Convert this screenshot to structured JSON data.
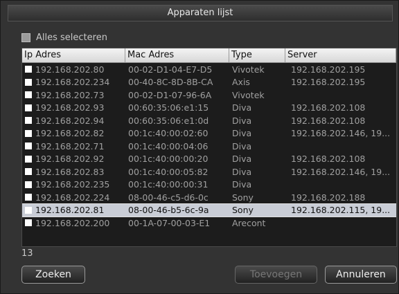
{
  "dialog": {
    "title": "Apparaten lijst",
    "select_all_label": "Alles selecteren",
    "count": "13"
  },
  "table": {
    "headers": [
      "Ip Adres",
      "Mac Adres",
      "Type",
      "Server"
    ],
    "rows": [
      {
        "ip": "192.168.202.80",
        "mac": "00-02-D1-04-E7-D5",
        "type": "Vivotek",
        "server": "192.168.202.195"
      },
      {
        "ip": "192.168.202.234",
        "mac": "00-40-8C-8D-8B-CA",
        "type": "Axis",
        "server": "192.168.202.195"
      },
      {
        "ip": "192.168.202.73",
        "mac": "00-02-D1-07-96-6A",
        "type": "Vivotek",
        "server": ""
      },
      {
        "ip": "192.168.202.93",
        "mac": "00:60:35:06:e1:15",
        "type": "Diva",
        "server": "192.168.202.108"
      },
      {
        "ip": "192.168.202.94",
        "mac": "00:60:35:06:e1:0d",
        "type": "Diva",
        "server": "192.168.202.108"
      },
      {
        "ip": "192.168.202.82",
        "mac": "00:1c:40:00:02:60",
        "type": "Diva",
        "server": "192.168.202.146, 19..."
      },
      {
        "ip": "192.168.202.71",
        "mac": "00:1c:40:00:04:06",
        "type": "Diva",
        "server": ""
      },
      {
        "ip": "192.168.202.92",
        "mac": "00:1c:40:00:00:20",
        "type": "Diva",
        "server": "192.168.202.108"
      },
      {
        "ip": "192.168.202.83",
        "mac": "00:1c:40:00:05:82",
        "type": "Diva",
        "server": "192.168.202.146, 19..."
      },
      {
        "ip": "192.168.202.235",
        "mac": "00:1c:40:00:00:31",
        "type": "Diva",
        "server": ""
      },
      {
        "ip": "192.168.202.224",
        "mac": "08-00-46-c5-d6-0c",
        "type": "Sony",
        "server": "192.168.202.188"
      },
      {
        "ip": "192.168.202.81",
        "mac": "08-00-46-b5-6c-9a",
        "type": "Sony",
        "server": "192.168.202.115, 19..."
      },
      {
        "ip": "192.168.202.200",
        "mac": "00-1A-07-00-03-E1",
        "type": "Arecont",
        "server": ""
      }
    ],
    "selected_row": 11
  },
  "buttons": {
    "search": "Zoeken",
    "add": "Toevoegen",
    "cancel": "Annuleren"
  }
}
